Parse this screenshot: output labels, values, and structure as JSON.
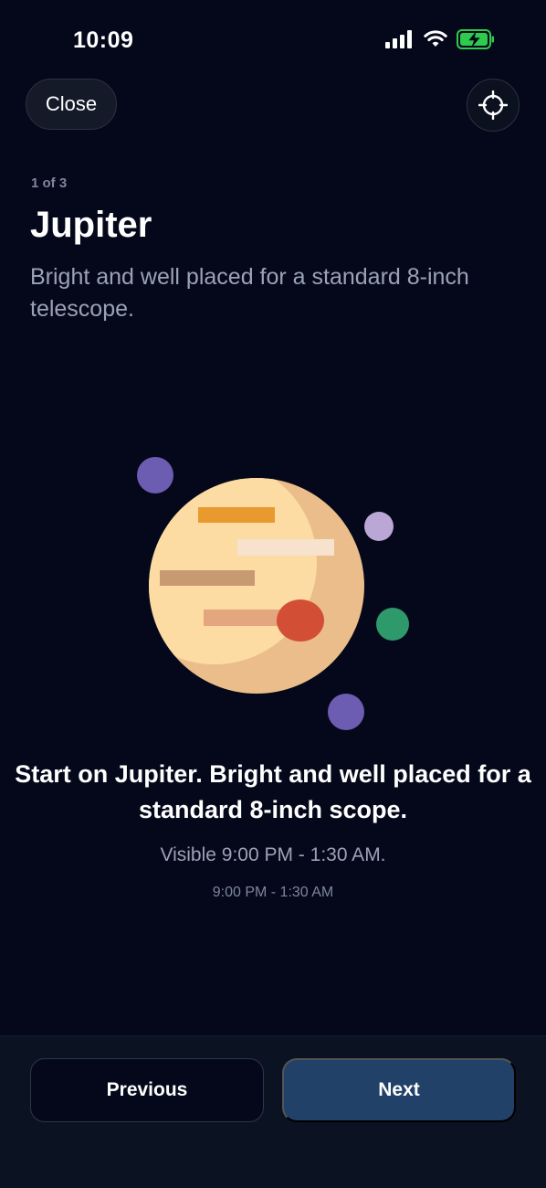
{
  "status_bar": {
    "time": "10:09",
    "icons": [
      "cellular-signal-icon",
      "wifi-icon",
      "battery-charging-icon"
    ]
  },
  "header": {
    "close_label": "Close",
    "locate_icon": "crosshair-icon"
  },
  "target": {
    "step": "1 of 3",
    "title": "Jupiter",
    "subtitle": "Bright and well placed for a standard 8-inch telescope."
  },
  "body": {
    "headline": "Start on Jupiter. Bright and well placed for a standard 8-inch scope.",
    "visible_text": "Visible 9:00 PM - 1:30 AM.",
    "time_range": "9:00 PM - 1:30 AM"
  },
  "footer": {
    "previous_label": "Previous",
    "next_label": "Next"
  },
  "colors": {
    "background": "#04081a",
    "next_button": "#214168",
    "planet_light": "#fcdca3",
    "planet_shade": "#ebbd8a",
    "great_red_spot": "#d24f36",
    "moon_purple": "#6c5cb2",
    "moon_lilac": "#bba7d6",
    "moon_green": "#2e9a6b"
  }
}
